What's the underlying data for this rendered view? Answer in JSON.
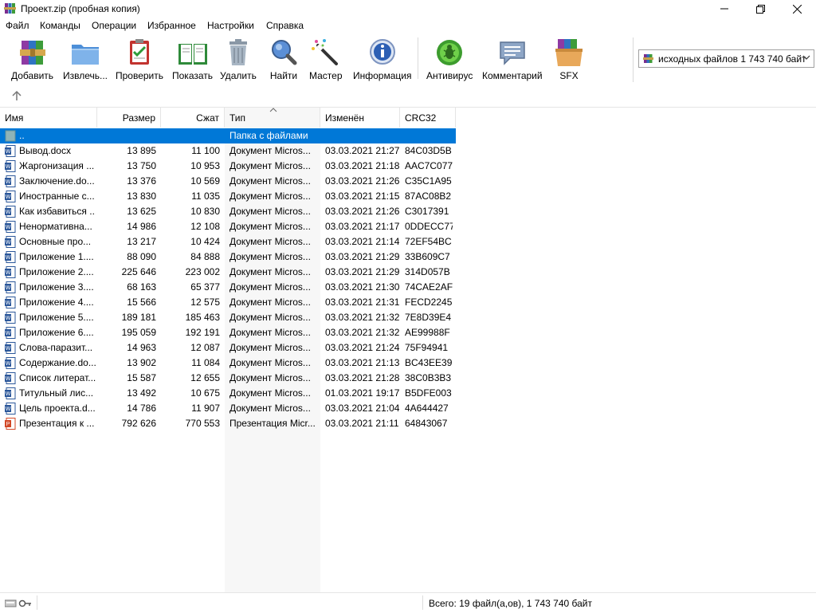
{
  "window": {
    "title": "Проект.zip (пробная копия)"
  },
  "menu": [
    "Файл",
    "Команды",
    "Операции",
    "Избранное",
    "Настройки",
    "Справка"
  ],
  "toolbar": {
    "add": "Добавить",
    "extract": "Извлечь...",
    "test": "Проверить",
    "view": "Показать",
    "delete": "Удалить",
    "find": "Найти",
    "wizard": "Мастер",
    "info": "Информация",
    "antivirus": "Антивирус",
    "comment": "Комментарий",
    "sfx": "SFX"
  },
  "dropdown": {
    "value": "исходных файлов 1 743 740 байт"
  },
  "columns": {
    "name": "Имя",
    "size": "Размер",
    "packed": "Сжат",
    "type": "Тип",
    "modified": "Изменён",
    "crc": "CRC32"
  },
  "parent_row": {
    "name": "..",
    "type": "Папка с файлами"
  },
  "files": [
    {
      "name": "Вывод.docx",
      "size": "13 895",
      "packed": "11 100",
      "type": "Документ Micros...",
      "modified": "03.03.2021 21:27",
      "crc": "84C03D5B",
      "icon": "word-doc-icon"
    },
    {
      "name": "Жаргонизация ...",
      "size": "13 750",
      "packed": "10 953",
      "type": "Документ Micros...",
      "modified": "03.03.2021 21:18",
      "crc": "AAC7C077",
      "icon": "word-doc-icon"
    },
    {
      "name": "Заключение.do...",
      "size": "13 376",
      "packed": "10 569",
      "type": "Документ Micros...",
      "modified": "03.03.2021 21:26",
      "crc": "C35C1A95",
      "icon": "word-doc-icon"
    },
    {
      "name": "Иностранные с...",
      "size": "13 830",
      "packed": "11 035",
      "type": "Документ Micros...",
      "modified": "03.03.2021 21:15",
      "crc": "87AC08B2",
      "icon": "word-doc-icon"
    },
    {
      "name": "Как избавиться ...",
      "size": "13 625",
      "packed": "10 830",
      "type": "Документ Micros...",
      "modified": "03.03.2021 21:26",
      "crc": "C3017391",
      "icon": "word-doc-icon"
    },
    {
      "name": "Ненормативна...",
      "size": "14 986",
      "packed": "12 108",
      "type": "Документ Micros...",
      "modified": "03.03.2021 21:17",
      "crc": "0DDECC77",
      "icon": "word-doc-icon"
    },
    {
      "name": "Основные про...",
      "size": "13 217",
      "packed": "10 424",
      "type": "Документ Micros...",
      "modified": "03.03.2021 21:14",
      "crc": "72EF54BC",
      "icon": "word-doc-icon"
    },
    {
      "name": "Приложение 1....",
      "size": "88 090",
      "packed": "84 888",
      "type": "Документ Micros...",
      "modified": "03.03.2021 21:29",
      "crc": "33B609C7",
      "icon": "word-doc-icon"
    },
    {
      "name": "Приложение 2....",
      "size": "225 646",
      "packed": "223 002",
      "type": "Документ Micros...",
      "modified": "03.03.2021 21:29",
      "crc": "314D057B",
      "icon": "word-doc-icon"
    },
    {
      "name": "Приложение 3....",
      "size": "68 163",
      "packed": "65 377",
      "type": "Документ Micros...",
      "modified": "03.03.2021 21:30",
      "crc": "74CAE2AF",
      "icon": "word-doc-icon"
    },
    {
      "name": "Приложение 4....",
      "size": "15 566",
      "packed": "12 575",
      "type": "Документ Micros...",
      "modified": "03.03.2021 21:31",
      "crc": "FECD2245",
      "icon": "word-doc-icon"
    },
    {
      "name": "Приложение 5....",
      "size": "189 181",
      "packed": "185 463",
      "type": "Документ Micros...",
      "modified": "03.03.2021 21:32",
      "crc": "7E8D39E4",
      "icon": "word-doc-icon"
    },
    {
      "name": "Приложение 6....",
      "size": "195 059",
      "packed": "192 191",
      "type": "Документ Micros...",
      "modified": "03.03.2021 21:32",
      "crc": "AE99988F",
      "icon": "word-doc-icon"
    },
    {
      "name": "Слова-паразит...",
      "size": "14 963",
      "packed": "12 087",
      "type": "Документ Micros...",
      "modified": "03.03.2021 21:24",
      "crc": "75F94941",
      "icon": "word-doc-icon"
    },
    {
      "name": "Содержание.do...",
      "size": "13 902",
      "packed": "11 084",
      "type": "Документ Micros...",
      "modified": "03.03.2021 21:13",
      "crc": "BC43EE39",
      "icon": "word-doc-icon"
    },
    {
      "name": "Список литерат...",
      "size": "15 587",
      "packed": "12 655",
      "type": "Документ Micros...",
      "modified": "03.03.2021 21:28",
      "crc": "38C0B3B3",
      "icon": "word-doc-icon"
    },
    {
      "name": "Титульный лис...",
      "size": "13 492",
      "packed": "10 675",
      "type": "Документ Micros...",
      "modified": "01.03.2021 19:17",
      "crc": "B5DFE003",
      "icon": "word-doc-icon"
    },
    {
      "name": "Цель проекта.d...",
      "size": "14 786",
      "packed": "11 907",
      "type": "Документ Micros...",
      "modified": "03.03.2021 21:04",
      "crc": "4A644427",
      "icon": "word-doc-icon"
    },
    {
      "name": "Презентация к ...",
      "size": "792 626",
      "packed": "770 553",
      "type": "Презентация Micr...",
      "modified": "03.03.2021 21:11",
      "crc": "64843067",
      "icon": "powerpoint-icon"
    }
  ],
  "status": {
    "total": "Всего: 19 файл(а,ов), 1 743 740 байт"
  },
  "colors": {
    "selection": "#0078d7",
    "word": "#2b579a",
    "powerpoint": "#d24726"
  }
}
